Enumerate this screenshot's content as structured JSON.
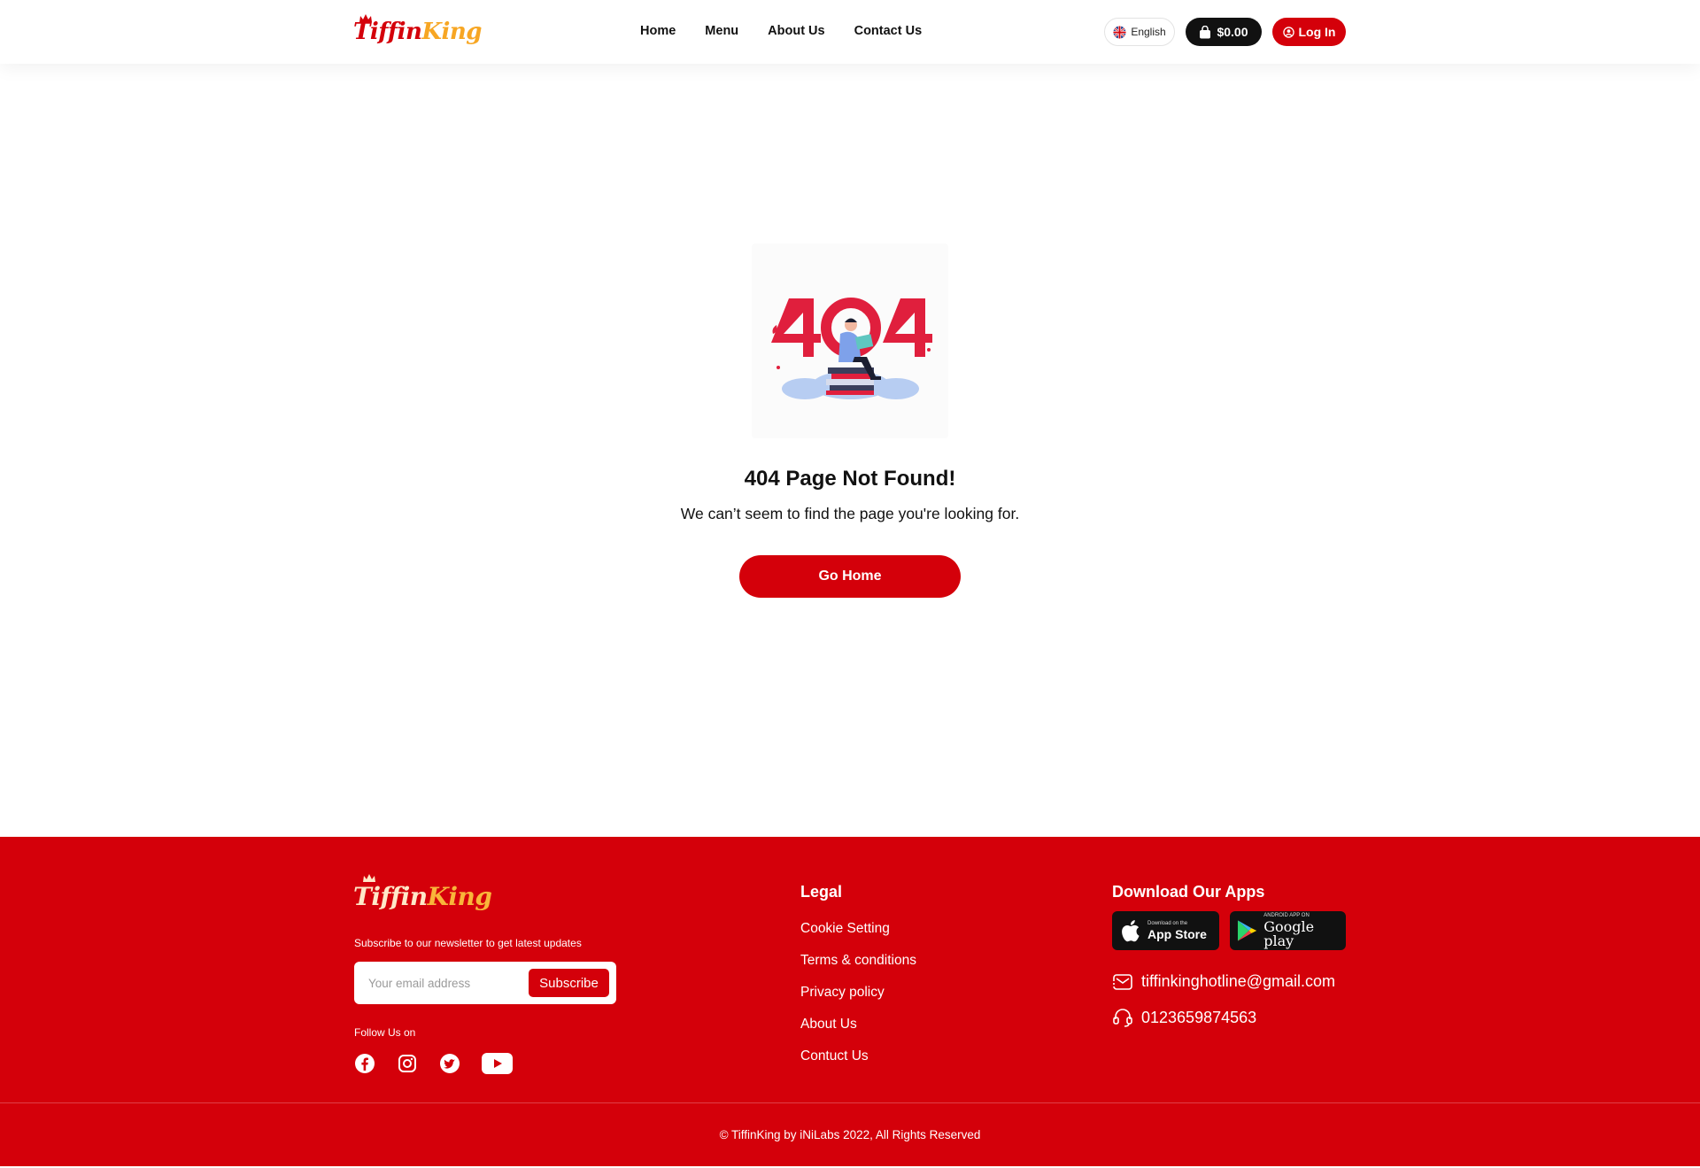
{
  "header": {
    "logo_text_1": "Tiffin",
    "logo_text_2": "King",
    "nav": [
      "Home",
      "Menu",
      "About Us",
      "Contact Us"
    ],
    "language": "English",
    "cart_total": "$0.00",
    "login_label": "Log In"
  },
  "main": {
    "title": "404 Page Not Found!",
    "subtitle": "We can’t seem to find the page you're looking for.",
    "go_home_label": "Go Home"
  },
  "footer": {
    "logo_text_1": "Tiffin",
    "logo_text_2": "King",
    "newsletter_text": "Subscribe to our newsletter to get latest updates",
    "email_placeholder": "Your email address",
    "subscribe_label": "Subscribe",
    "follow_label": "Follow Us on",
    "socials": [
      "facebook-icon",
      "instagram-icon",
      "twitter-icon",
      "youtube-icon"
    ],
    "legal_heading": "Legal",
    "legal_links": [
      "Cookie Setting",
      "Terms & conditions",
      "Privacy policy",
      "About Us",
      "Contuct Us"
    ],
    "apps_heading": "Download Our Apps",
    "app_store_small": "Download on the",
    "app_store_big": "App Store",
    "play_store_small": "ANDROID APP ON",
    "play_store_big": "Google play",
    "email": "tiffinkinghotline@gmail.com",
    "phone": "0123659874563",
    "copyright": "© TiffinKing by iNiLabs 2022, All Rights Reserved"
  },
  "colors": {
    "brand_red": "#d4000a",
    "brand_orange": "#f7a623",
    "dark": "#111111"
  }
}
